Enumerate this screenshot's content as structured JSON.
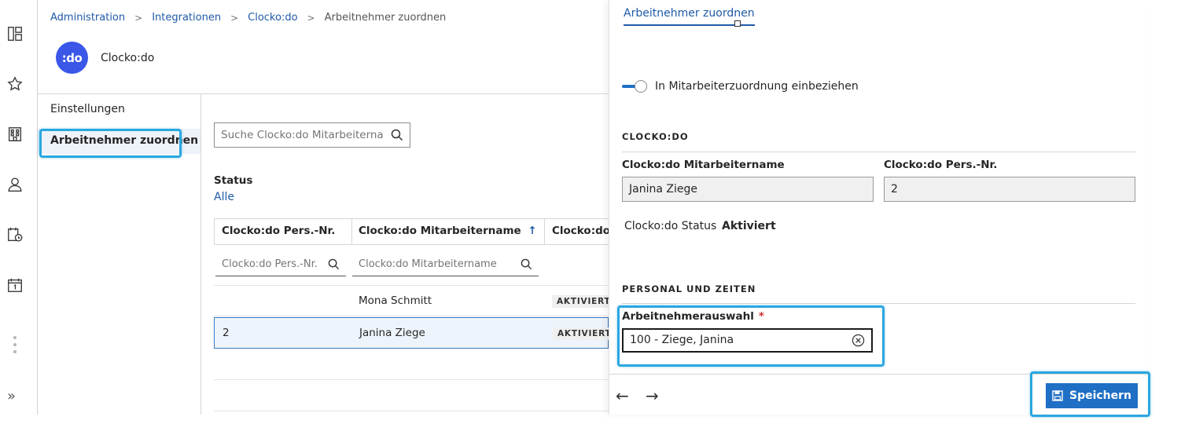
{
  "rail": {
    "icons": [
      "dashboard-icon",
      "star-icon",
      "building-icon",
      "person-icon",
      "calendar-clock-icon",
      "calendar-icon",
      "more-icon",
      "expand-icon"
    ]
  },
  "breadcrumb": {
    "items": [
      "Administration",
      "Integrationen",
      "Clocko:do",
      "Arbeitnehmer zuordnen"
    ]
  },
  "app": {
    "logo_text": ":do",
    "title": "Clocko:do"
  },
  "subnav": {
    "items": [
      "Einstellungen",
      "Arbeitnehmer zuordnen"
    ]
  },
  "main": {
    "search_placeholder": "Suche Clocko:do Mitarbeiterna...",
    "status_label": "Status",
    "status_value": "Alle"
  },
  "table": {
    "columns": [
      "Clocko:do Pers.-Nr.",
      "Clocko:do Mitarbeitername",
      "Clocko:do S"
    ],
    "sort_indicator": "↑",
    "filter_placeholders": [
      "Clocko:do Pers.-Nr.",
      "Clocko:do Mitarbeitername"
    ],
    "rows": [
      {
        "nr": "",
        "name": "Mona Schmitt",
        "status": "AKTIVIERT"
      },
      {
        "nr": "2",
        "name": "Janina Ziege",
        "status": "AKTIVIERT"
      }
    ]
  },
  "panel": {
    "tab": "Arbeitnehmer zuordnen",
    "toggle_label": "In Mitarbeiterzuordnung einbeziehen",
    "section1": "CLOCKO:DO",
    "name_label": "Clocko:do Mitarbeitername",
    "name_value": "Janina Ziege",
    "nr_label": "Clocko:do Pers.-Nr.",
    "nr_value": "2",
    "status_label": "Clocko:do Status",
    "status_value": "Aktiviert",
    "section2": "PERSONAL UND ZEITEN",
    "select_label": "Arbeitnehmerauswahl",
    "required_mark": "*",
    "select_value": "100 - Ziege, Janina",
    "prev": "←",
    "next": "→",
    "save": "Speichern"
  },
  "colors": {
    "accent": "#1f6fc4",
    "link": "#1f5aa6",
    "highlight": "#2aa7e0",
    "logo": "#3a57e8"
  }
}
